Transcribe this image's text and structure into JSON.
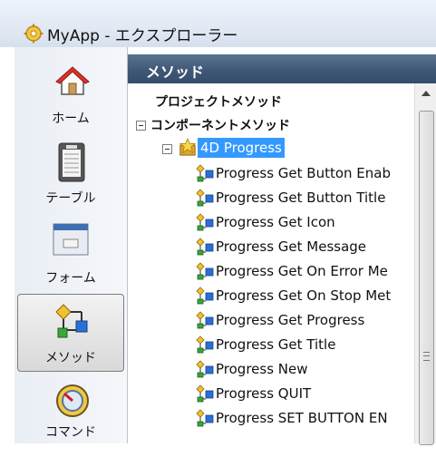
{
  "window": {
    "title": "MyApp - エクスプローラー"
  },
  "sidebar": {
    "items": [
      {
        "label": "ホーム",
        "icon": "home-icon"
      },
      {
        "label": "テーブル",
        "icon": "table-icon"
      },
      {
        "label": "フォーム",
        "icon": "form-icon"
      },
      {
        "label": "メソッド",
        "icon": "method-icon",
        "selected": true
      },
      {
        "label": "コマンド",
        "icon": "command-icon"
      }
    ]
  },
  "panel": {
    "header": "メソッド",
    "tree": {
      "project_methods": "プロジェクトメソッド",
      "component_methods": "コンポーネントメソッド",
      "component": "4D Progress",
      "methods": [
        "Progress Get Button Enab",
        "Progress Get Button Title",
        "Progress Get Icon",
        "Progress Get Message",
        "Progress Get On Error Me",
        "Progress Get On Stop Met",
        "Progress Get Progress",
        "Progress Get Title",
        "Progress New",
        "Progress QUIT",
        "Progress SET BUTTON EN"
      ]
    }
  },
  "colors": {
    "header_bg": "#3f5876",
    "selection": "#3399ff"
  }
}
